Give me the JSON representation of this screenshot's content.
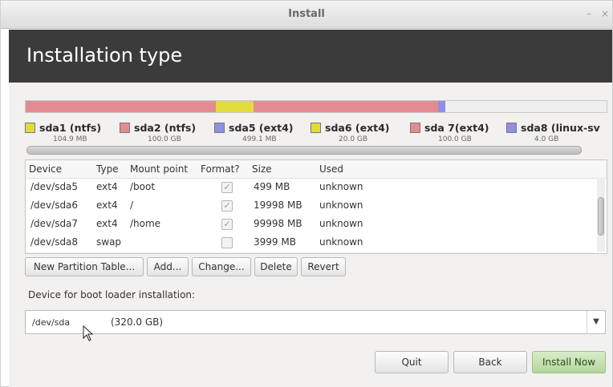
{
  "window": {
    "title": "Install",
    "minimize": "–",
    "close": "×"
  },
  "header": {
    "title": "Installation type"
  },
  "partition_bar": {
    "segments": [
      {
        "color": "#e28c92",
        "share": 0.327
      },
      {
        "color": "#e1dc3c",
        "share": 0.065
      },
      {
        "color": "#e28c92",
        "share": 0.318
      },
      {
        "color": "#8f8fe3",
        "share": 0.013
      },
      {
        "color": "#efefef",
        "share": 0.277
      }
    ],
    "legend": [
      {
        "name": "sda1 (ntfs)",
        "size": "104.9 MB",
        "color": "#e1dc3c"
      },
      {
        "name": "sda2 (ntfs)",
        "size": "100.0 GB",
        "color": "#e28c92"
      },
      {
        "name": "sda5 (ext4)",
        "size": "499.1 MB",
        "color": "#8f8fe3"
      },
      {
        "name": "sda6 (ext4)",
        "size": "20.0 GB",
        "color": "#e1dc3c"
      },
      {
        "name": "sda 7(ext4)",
        "size": "100.0 GB",
        "color": "#e28c92"
      },
      {
        "name": "sda8 (linux-sv",
        "size": "4.0 GB",
        "color": "#8f8fe3"
      }
    ]
  },
  "table": {
    "columns": [
      "Device",
      "Type",
      "Mount point",
      "Format?",
      "Size",
      "Used"
    ],
    "rows": [
      {
        "device": "/dev/sda5",
        "type": "ext4",
        "mount": "/boot",
        "format": true,
        "size": "499 MB",
        "used": "unknown"
      },
      {
        "device": "/dev/sda6",
        "type": "ext4",
        "mount": "/",
        "format": true,
        "size": "19998 MB",
        "used": "unknown"
      },
      {
        "device": "/dev/sda7",
        "type": "ext4",
        "mount": "/home",
        "format": true,
        "size": "99998 MB",
        "used": "unknown"
      },
      {
        "device": "/dev/sda8",
        "type": "swap",
        "mount": "",
        "format": false,
        "size": "3999 MB",
        "used": "unknown"
      }
    ]
  },
  "table_buttons": {
    "new_table": "New Partition Table...",
    "add": "Add...",
    "change": "Change...",
    "delete": "Delete",
    "revert": "Revert"
  },
  "bootloader": {
    "label": "Device for boot loader installation:",
    "device": "/dev/sda",
    "capacity": "(320.0 GB)",
    "arrow": "▼"
  },
  "actions": {
    "quit": "Quit",
    "back": "Back",
    "install": "Install Now"
  },
  "check_glyph": "✓"
}
